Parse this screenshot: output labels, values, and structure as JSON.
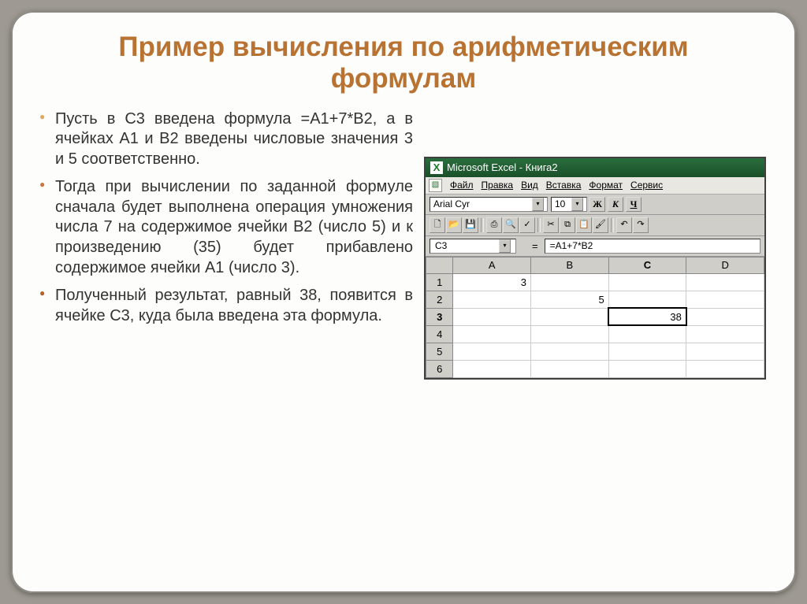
{
  "slide": {
    "title": "Пример вычисления по арифметическим формулам"
  },
  "bullets": {
    "b1": "Пусть в С3 введена формула =А1+7*В2, а в ячейках А1 и В2 введены числовые значения 3 и 5 соответственно.",
    "b2": "Тогда при вычислении по заданной формуле сначала будет выполнена операция умножения числа 7 на содержимое ячейки В2 (число 5) и к произведению (35) будет прибавлено содержимое ячейки А1 (число 3).",
    "b3": "Полученный результат, равный 38, появится в ячейке С3, куда была введена эта формула."
  },
  "excel": {
    "app_title": "Microsoft Excel - Книга2",
    "menu": {
      "file": "Файл",
      "edit": "Правка",
      "view": "Вид",
      "insert": "Вставка",
      "format": "Формат",
      "service": "Сервис"
    },
    "font_name": "Arial Cyr",
    "font_size": "10",
    "bold": "Ж",
    "italic": "К",
    "underline": "Ч",
    "active_cell": "C3",
    "formula": "=A1+7*B2",
    "columns": {
      "a": "A",
      "b": "B",
      "c": "C",
      "d": "D"
    },
    "rows": {
      "r1": "1",
      "r2": "2",
      "r3": "3",
      "r4": "4",
      "r5": "5",
      "r6": "6"
    },
    "cells": {
      "a1": "3",
      "b2": "5",
      "c3": "38"
    }
  }
}
